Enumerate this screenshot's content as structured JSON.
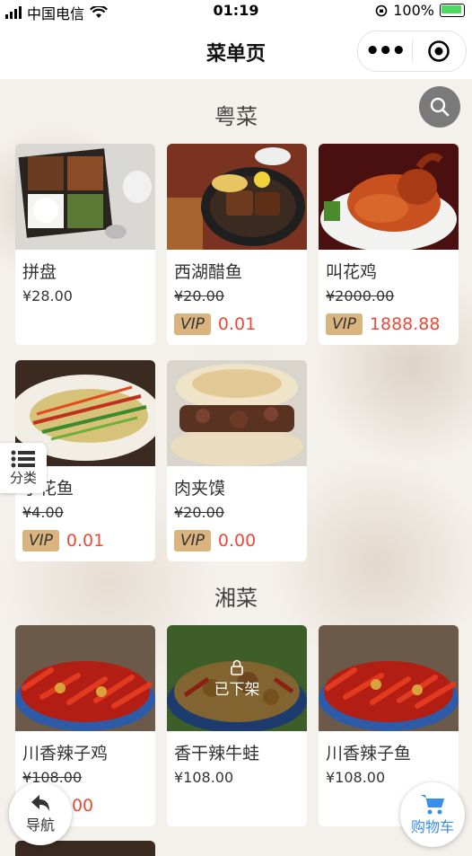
{
  "status_bar": {
    "carrier": "中国电信",
    "time": "01:19",
    "battery": "100%"
  },
  "nav": {
    "title": "菜单页",
    "more_icon": "more-dots-icon",
    "target_icon": "target-icon"
  },
  "sections": [
    {
      "title": "粤菜",
      "items": [
        {
          "name": "拼盘",
          "price": "¥28.00",
          "strike": false,
          "vip": null
        },
        {
          "name": "西湖醋鱼",
          "price": "¥20.00",
          "strike": true,
          "vip": "0.01"
        },
        {
          "name": "叫花鸡",
          "price": "¥2000.00",
          "strike": true,
          "vip": "1888.88"
        },
        {
          "name": "小花鱼",
          "price": "¥4.00",
          "strike": true,
          "vip": "0.01"
        },
        {
          "name": "肉夹馍",
          "price": "¥20.00",
          "strike": true,
          "vip": "0.00"
        }
      ]
    },
    {
      "title": "湘菜",
      "items": [
        {
          "name": "川香辣子鸡",
          "price": "¥108.00",
          "strike": true,
          "vip": ".00"
        },
        {
          "name": "香干辣牛蛙",
          "price": "¥108.00",
          "strike": false,
          "vip": null,
          "off_shelf": "已下架"
        },
        {
          "name": "川香辣子鱼",
          "price": "¥108.00",
          "strike": false,
          "vip": null
        }
      ]
    }
  ],
  "vip_label": "VIP",
  "floating": {
    "category": "分类",
    "navigate": "导航",
    "cart": "购物车"
  },
  "colors": {
    "vip_badge": "#d9b47e",
    "vip_price": "#e94a3a",
    "cart_blue": "#3a8ee6"
  }
}
